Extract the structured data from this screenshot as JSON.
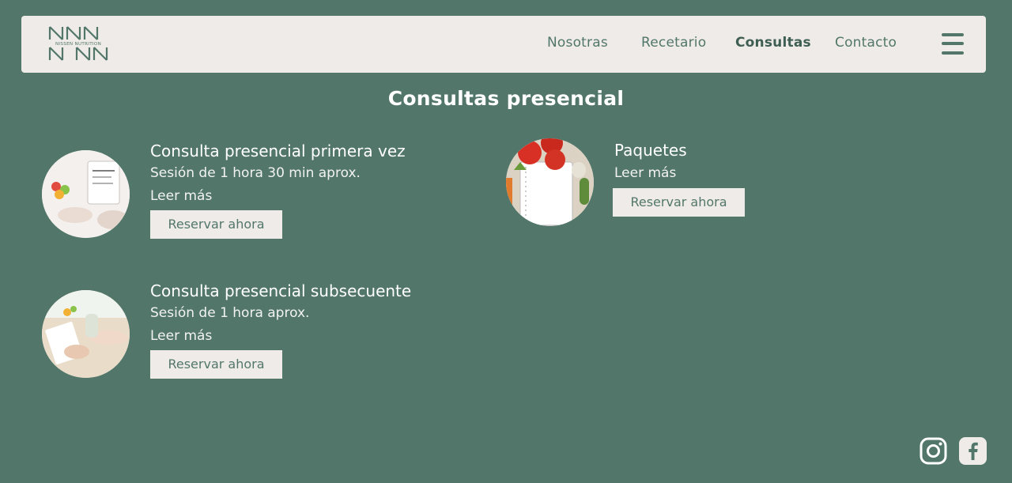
{
  "brand": {
    "logo_text": "NISSEN NUTRITION",
    "logo_initials": "NN"
  },
  "nav": {
    "items": [
      {
        "label": "Nosotras"
      },
      {
        "label": "Recetario"
      },
      {
        "label": "Consultas",
        "active": true
      },
      {
        "label": "Contacto"
      }
    ],
    "menu_icon": "hamburger-menu-icon"
  },
  "main": {
    "title": "Consultas presencial",
    "cards": [
      {
        "title": "Consulta presencial primera vez",
        "description": "Sesión de 1 hora 30 min aprox.",
        "link": "Leer más",
        "button": "Reservar ahora"
      },
      {
        "title": "Paquetes",
        "link": "Leer más",
        "button": "Reservar ahora"
      },
      {
        "title": "Consulta presencial subsecuente",
        "description": "Sesión de 1 hora aprox.",
        "link": "Leer más",
        "button": "Reservar ahora"
      }
    ]
  },
  "footer": {
    "icons": [
      "instagram-icon",
      "facebook-icon"
    ]
  },
  "colors": {
    "background": "#52776a",
    "surface": "#efebe8",
    "text_light": "#ffffff",
    "accent": "#52776a"
  }
}
